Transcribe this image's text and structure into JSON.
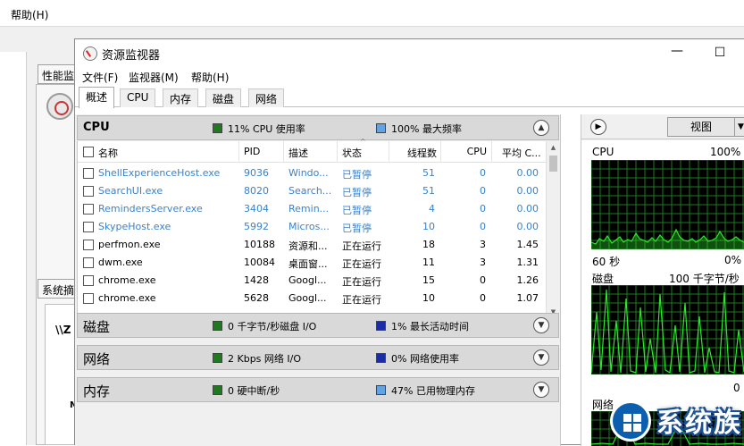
{
  "background_window": {
    "help_menu": "帮助(H)",
    "tab_performance": "性能监",
    "tab_system": "系统摘",
    "system_text": "\\\\Z",
    "system_side_letter": "M"
  },
  "window": {
    "title": "资源监视器",
    "minimize": "—",
    "maximize": "☐"
  },
  "menubar": {
    "file": "文件(F)",
    "monitor": "监视器(M)",
    "help": "帮助(H)"
  },
  "tabs": [
    {
      "label": "概述",
      "active": true
    },
    {
      "label": "CPU",
      "active": false
    },
    {
      "label": "内存",
      "active": false
    },
    {
      "label": "磁盘",
      "active": false
    },
    {
      "label": "网络",
      "active": false
    }
  ],
  "sections": {
    "cpu": {
      "title": "CPU",
      "stat1": "11% CPU 使用率",
      "stat2": "100% 最大频率",
      "stat1_color": "#1f7a1f",
      "stat2_color": "#62a3e6"
    },
    "disk": {
      "title": "磁盘",
      "stat1": "0 千字节/秒磁盘 I/O",
      "stat2": "1% 最长活动时间",
      "stat1_color": "#1f7a1f",
      "stat2_color": "#1a2ca8"
    },
    "network": {
      "title": "网络",
      "stat1": "2 Kbps 网络 I/O",
      "stat2": "0% 网络使用率",
      "stat1_color": "#1f7a1f",
      "stat2_color": "#1a2ca8"
    },
    "memory": {
      "title": "内存",
      "stat1": "0 硬中断/秒",
      "stat2": "47% 已用物理内存",
      "stat1_color": "#1f7a1f",
      "stat2_color": "#62a3e6"
    }
  },
  "process_table": {
    "columns": [
      "名称",
      "PID",
      "描述",
      "状态",
      "线程数",
      "CPU",
      "平均 C..."
    ],
    "rows": [
      {
        "name": "ShellExperienceHost.exe",
        "pid": "9036",
        "desc": "Windo...",
        "status": "已暂停",
        "threads": "51",
        "cpu": "0",
        "avg": "0.00",
        "suspended": true
      },
      {
        "name": "SearchUI.exe",
        "pid": "8020",
        "desc": "Search...",
        "status": "已暂停",
        "threads": "51",
        "cpu": "0",
        "avg": "0.00",
        "suspended": true
      },
      {
        "name": "RemindersServer.exe",
        "pid": "3404",
        "desc": "Remin...",
        "status": "已暂停",
        "threads": "4",
        "cpu": "0",
        "avg": "0.00",
        "suspended": true
      },
      {
        "name": "SkypeHost.exe",
        "pid": "5992",
        "desc": "Micros...",
        "status": "已暂停",
        "threads": "10",
        "cpu": "0",
        "avg": "0.00",
        "suspended": true
      },
      {
        "name": "perfmon.exe",
        "pid": "10188",
        "desc": "资源和...",
        "status": "正在运行",
        "threads": "18",
        "cpu": "3",
        "avg": "1.45",
        "suspended": false
      },
      {
        "name": "dwm.exe",
        "pid": "10084",
        "desc": "桌面窗...",
        "status": "正在运行",
        "threads": "11",
        "cpu": "3",
        "avg": "1.31",
        "suspended": false
      },
      {
        "name": "chrome.exe",
        "pid": "1428",
        "desc": "Googl...",
        "status": "正在运行",
        "threads": "15",
        "cpu": "0",
        "avg": "1.26",
        "suspended": false
      },
      {
        "name": "chrome.exe",
        "pid": "5628",
        "desc": "Googl...",
        "status": "正在运行",
        "threads": "10",
        "cpu": "0",
        "avg": "1.07",
        "suspended": false
      }
    ]
  },
  "right_panel": {
    "view_label": "视图",
    "cpu_graph": {
      "label": "CPU",
      "max": "100%",
      "time": "60 秒",
      "min": "0%"
    },
    "disk_graph": {
      "label": "磁盘",
      "max": "100 千字节/秒",
      "min": "0"
    },
    "network_graph": {
      "label": "网络"
    }
  },
  "watermark": {
    "text": "系统族"
  },
  "colors": {
    "suspended_text": "#3b82c9",
    "graph_bg": "#000000",
    "graph_grid": "#1f7a1f",
    "graph_line": "#2ee82e"
  }
}
